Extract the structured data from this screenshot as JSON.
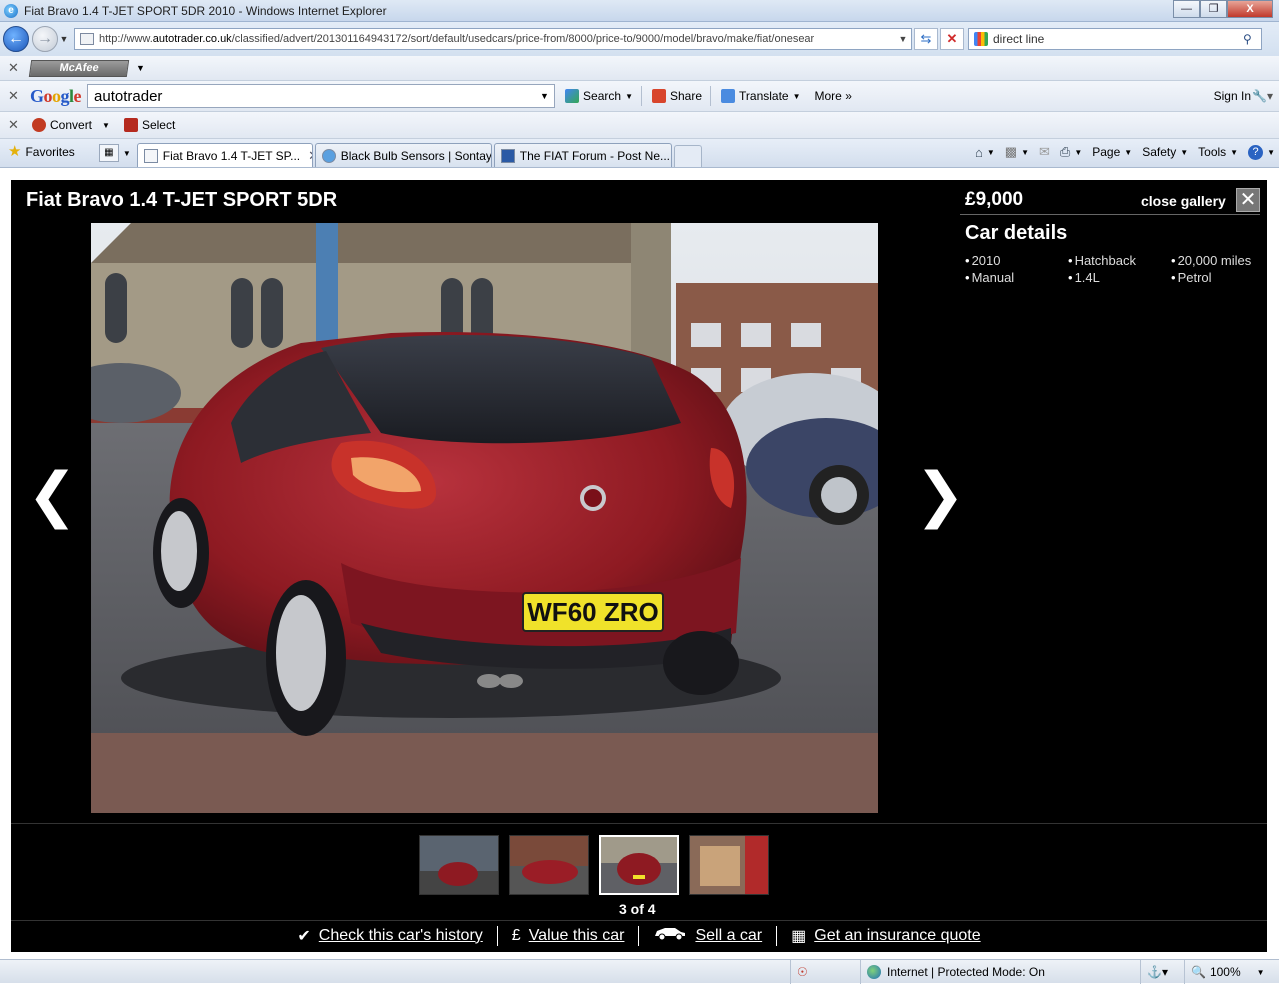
{
  "window": {
    "title": "Fiat Bravo 1.4 T-JET SPORT 5DR 2010 - Windows Internet Explorer",
    "minimize": "—",
    "maximize": "❐",
    "close": "X"
  },
  "address": {
    "url_prefix": "http://www.",
    "url_domain": "autotrader.co.uk",
    "url_rest": "/classified/advert/201301164943172/sort/default/usedcars/price-from/8000/price-to/9000/model/bravo/make/fiat/onesear",
    "search_value": "direct line"
  },
  "mcafee_toolbar": {
    "label": "McAfee"
  },
  "google_toolbar": {
    "query": "autotrader",
    "search": "Search",
    "share": "Share",
    "translate": "Translate",
    "more": "More »",
    "sign_in": "Sign In"
  },
  "convert_toolbar": {
    "convert": "Convert",
    "select": "Select"
  },
  "favorites_bar": {
    "favorites": "Favorites",
    "tabs": [
      {
        "label": "Fiat Bravo 1.4 T-JET SP...",
        "active": true
      },
      {
        "label": "Black Bulb Sensors | Sontay",
        "active": false
      },
      {
        "label": "The FIAT Forum - Post Ne...",
        "active": false
      }
    ],
    "commands": {
      "page": "Page",
      "safety": "Safety",
      "tools": "Tools"
    }
  },
  "gallery": {
    "title": "Fiat Bravo 1.4 T-JET SPORT 5DR",
    "price": "£9,000",
    "close_label": "close gallery",
    "details_title": "Car details",
    "details": [
      "2010",
      "Hatchback",
      "20,000 miles",
      "Manual",
      "1.4L",
      "Petrol"
    ],
    "plate": "WF60 ZRO",
    "counter": "3 of 4",
    "thumbnails": [
      {
        "selected": false
      },
      {
        "selected": false
      },
      {
        "selected": true
      },
      {
        "selected": false
      }
    ],
    "links": [
      {
        "icon": "check-icon",
        "glyph": "✔",
        "label": "Check this car's history"
      },
      {
        "icon": "pound-icon",
        "glyph": "£",
        "label": "Value this car"
      },
      {
        "icon": "car-icon",
        "glyph": "🚗",
        "label": "Sell a car"
      },
      {
        "icon": "calculator-icon",
        "glyph": "▦",
        "label": "Get an insurance quote"
      }
    ]
  },
  "status_bar": {
    "zone": "Internet | Protected Mode: On",
    "zoom": "100%"
  },
  "colors": {
    "gallery_bg": "#000000",
    "car_red": "#8e1a22",
    "plate_yellow": "#f0e22a"
  }
}
